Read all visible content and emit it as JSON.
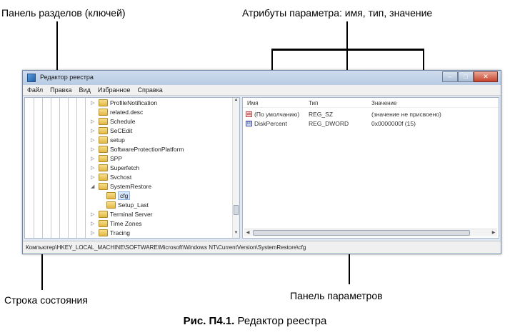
{
  "callouts": {
    "keys_pane": "Панель разделов (ключей)",
    "attributes": "Атрибуты параметра: имя, тип, значение",
    "status_bar": "Строка состояния",
    "values_pane": "Панель параметров"
  },
  "caption": {
    "label": "Рис. П4.1.",
    "text": " Редактор реестра"
  },
  "window": {
    "title": "Редактор реестра",
    "controls": {
      "minimize": "–",
      "maximize": "□",
      "close": "✕"
    }
  },
  "menu": [
    "Файл",
    "Правка",
    "Вид",
    "Избранное",
    "Справка"
  ],
  "tree": {
    "items": [
      {
        "label": "ProfileNotification",
        "expander": "▷"
      },
      {
        "label": "related.desc",
        "expander": ""
      },
      {
        "label": "Schedule",
        "expander": "▷"
      },
      {
        "label": "SeCEdit",
        "expander": "▷"
      },
      {
        "label": "setup",
        "expander": "▷"
      },
      {
        "label": "SoftwareProtectionPlatform",
        "expander": "▷"
      },
      {
        "label": "SPP",
        "expander": "▷"
      },
      {
        "label": "Superfetch",
        "expander": "▷"
      },
      {
        "label": "Svchost",
        "expander": "▷"
      },
      {
        "label": "SystemRestore",
        "expander": "◢"
      },
      {
        "label": "cfg",
        "expander": ""
      },
      {
        "label": "Setup_Last",
        "expander": ""
      },
      {
        "label": "Terminal Server",
        "expander": "▷"
      },
      {
        "label": "Time Zones",
        "expander": "▷"
      },
      {
        "label": "Tracing",
        "expander": "▷"
      }
    ],
    "selected": "cfg"
  },
  "values": {
    "headers": {
      "name": "Имя",
      "type": "Тип",
      "data": "Значение"
    },
    "rows": [
      {
        "icon": "ab",
        "name": "(По умолчанию)",
        "type": "REG_SZ",
        "data": "(значение не присвоено)"
      },
      {
        "icon": "01",
        "name": "DiskPercent",
        "type": "REG_DWORD",
        "data": "0x0000000f (15)"
      }
    ]
  },
  "status_bar": {
    "path": "Компьютер\\HKEY_LOCAL_MACHINE\\SOFTWARE\\Microsoft\\Windows NT\\CurrentVersion\\SystemRestore\\cfg"
  }
}
